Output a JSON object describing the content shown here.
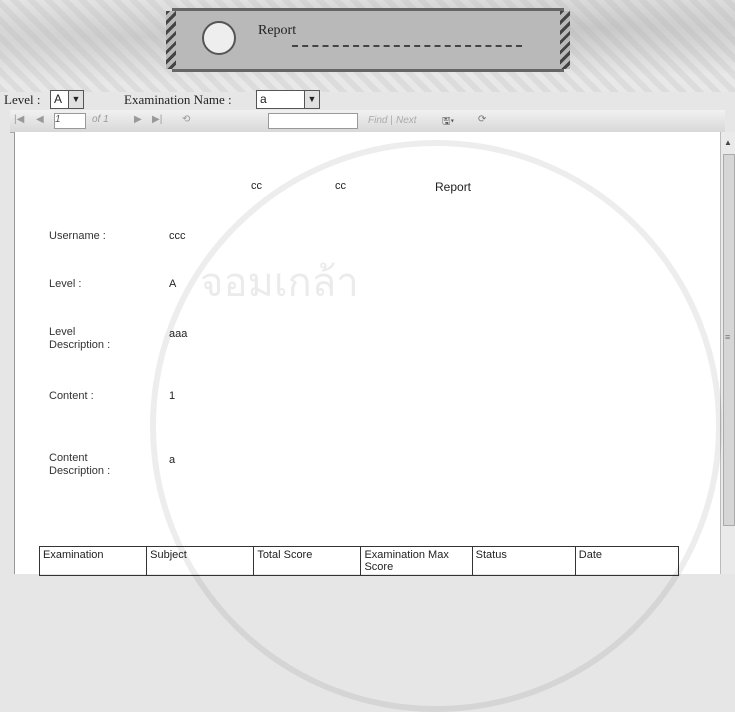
{
  "banner": {
    "title": "Report"
  },
  "filters": {
    "level_label": "Level :",
    "level_value": "A",
    "exam_label": "Examination Name :",
    "exam_value": "a"
  },
  "toolbar": {
    "page_current": "1",
    "page_of": "of 1",
    "find_label": "Find",
    "next_label": "Next"
  },
  "report": {
    "header_cc1": "cc",
    "header_cc2": "cc",
    "header_title": "Report",
    "fields": [
      {
        "label": "Username :",
        "value": "ccc"
      },
      {
        "label": "Level :",
        "value": "A"
      },
      {
        "label": "Level Description :",
        "value": "aaa"
      },
      {
        "label": "Content :",
        "value": "1"
      },
      {
        "label": "Content Description :",
        "value": "a"
      }
    ],
    "table_headers": [
      "Examination",
      "Subject",
      "Total Score",
      "Examination Max Score",
      "Status",
      "Date"
    ]
  },
  "watermark": "จอมเกล้า"
}
